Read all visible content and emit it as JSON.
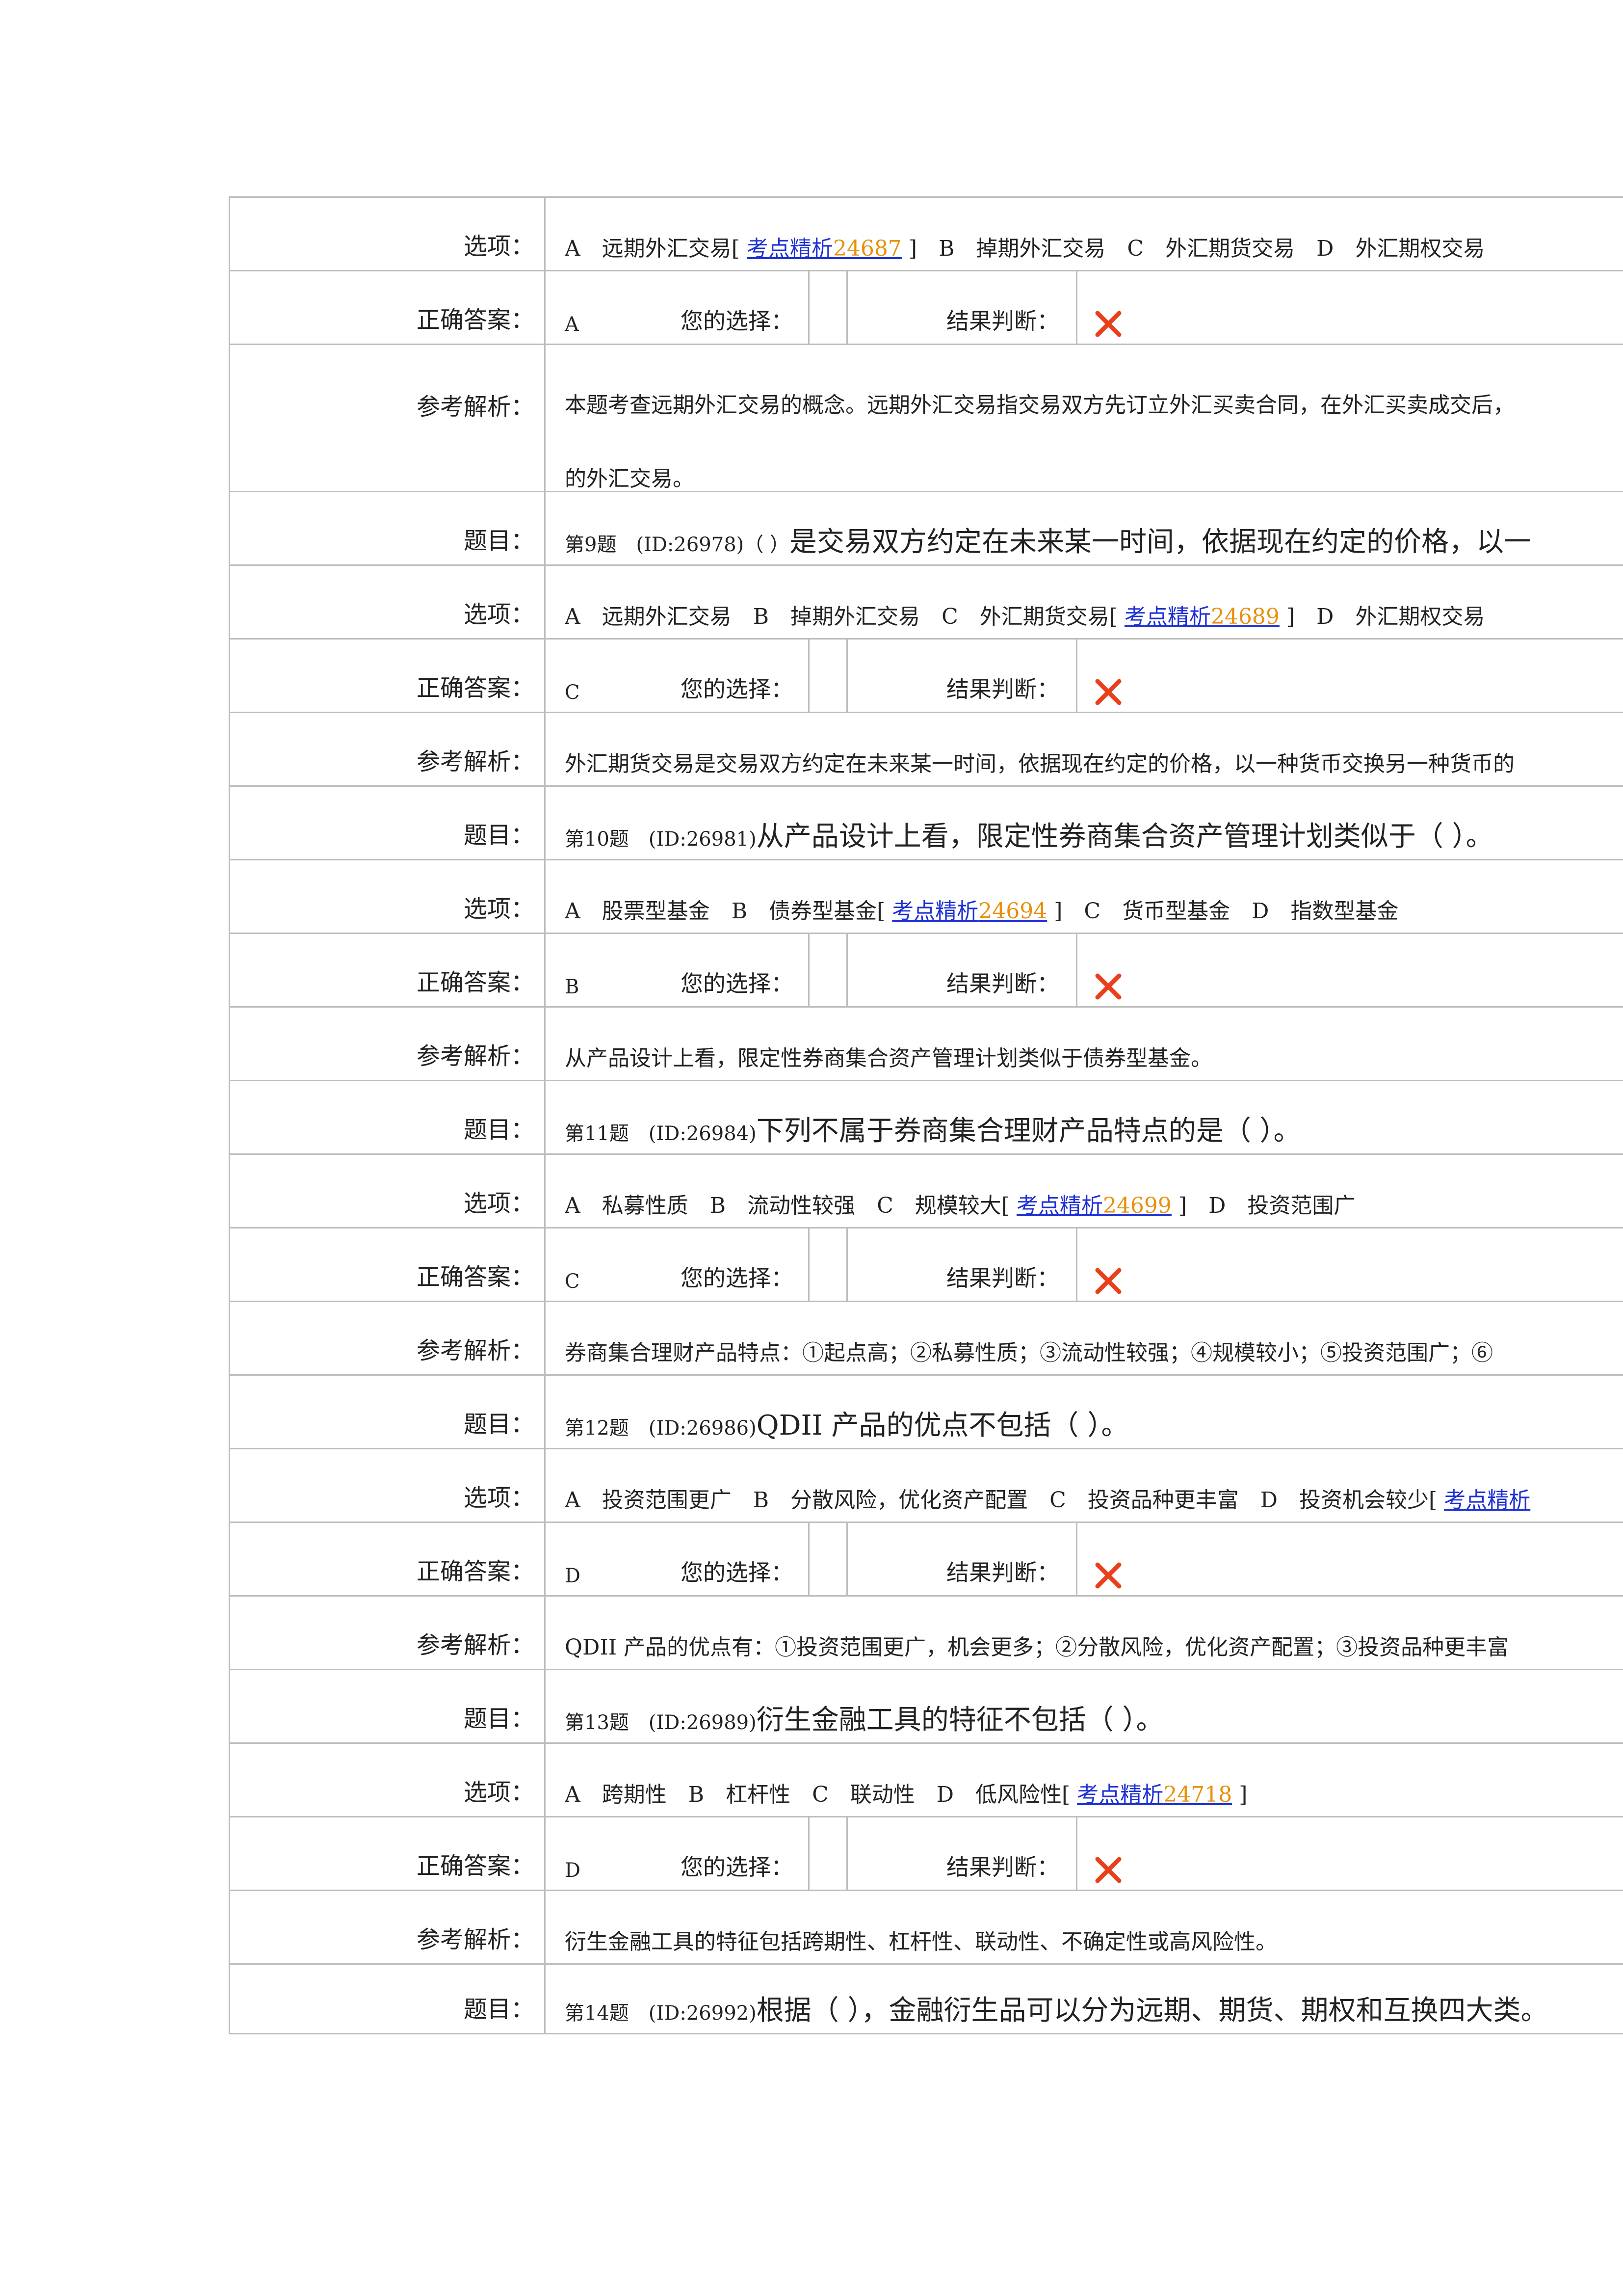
{
  "labels": {
    "options": "选项：",
    "answer": "正确答案：",
    "analysis": "参考解析：",
    "question": "题目：",
    "your_choice": "您的选择：",
    "result": "结果判断："
  },
  "colors": {
    "link": "#1d2fd6",
    "link_number": "#e8900a",
    "wrong_mark": "#e8401c",
    "border": "#bdbdbd"
  },
  "result_icon": "wrong-cross-icon",
  "q8": {
    "opt_pre": "A　远期外汇交易[ ",
    "link_text": "考点精析",
    "link_num": "24687",
    "opt_post": " ]　B　掉期外汇交易　C　外汇期货交易　D　外汇期权交易",
    "answer": "A",
    "analysis_line1": "本题考查远期外汇交易的概念。远期外汇交易指交易双方先订立外汇买卖合同，在外汇买卖成交后，",
    "analysis_line2": "的外汇交易。"
  },
  "q9": {
    "q_pre": "第9题　(ID:26978)（ ）",
    "q_main": "是交易双方约定在未来某一时间，依据现在约定的价格，以一",
    "opt_pre": "A　远期外汇交易　B　掉期外汇交易　C　外汇期货交易[ ",
    "link_text": "考点精析",
    "link_num": "24689",
    "opt_post": " ]　D　外汇期权交易",
    "answer": "C",
    "analysis": "外汇期货交易是交易双方约定在未来某一时间，依据现在约定的价格，以一种货币交换另一种货币的"
  },
  "q10": {
    "q_pre": "第10题　(ID:26981)",
    "q_main": "从产品设计上看，限定性券商集合资产管理计划类似于（ ）。",
    "opt_pre": "A　股票型基金　B　债券型基金[ ",
    "link_text": "考点精析",
    "link_num": "24694",
    "opt_post": " ]　C　货币型基金　D　指数型基金",
    "answer": "B",
    "analysis": "从产品设计上看，限定性券商集合资产管理计划类似于债券型基金。"
  },
  "q11": {
    "q_pre": "第11题　(ID:26984)",
    "q_main": "下列不属于券商集合理财产品特点的是（ ）。",
    "opt_pre": "A　私募性质　B　流动性较强　C　规模较大[ ",
    "link_text": "考点精析",
    "link_num": "24699",
    "opt_post": " ]　D　投资范围广",
    "answer": "C",
    "analysis": "券商集合理财产品特点：①起点高；②私募性质；③流动性较强；④规模较小；⑤投资范围广；⑥"
  },
  "q12": {
    "q_pre": "第12题　(ID:26986)",
    "q_main": "QDII 产品的优点不包括（ ）。",
    "opt_pre": "A　投资范围更广　B　分散风险，优化资产配置　C　投资品种更丰富　D　投资机会较少[ ",
    "link_text": "考点精析",
    "link_num": "",
    "opt_post": "",
    "answer": "D",
    "analysis": "QDII 产品的优点有：①投资范围更广，机会更多；②分散风险，优化资产配置；③投资品种更丰富"
  },
  "q13": {
    "q_pre": "第13题　(ID:26989)",
    "q_main": "衍生金融工具的特征不包括（ ）。",
    "opt_pre": "A　跨期性　B　杠杆性　C　联动性　D　低风险性[ ",
    "link_text": "考点精析",
    "link_num": "24718",
    "opt_post": " ]",
    "answer": "D",
    "analysis": "衍生金融工具的特征包括跨期性、杠杆性、联动性、不确定性或高风险性。"
  },
  "q14": {
    "q_pre": "第14题　(ID:26992)",
    "q_main": "根据（ ），金融衍生品可以分为远期、期货、期权和互换四大类。"
  }
}
